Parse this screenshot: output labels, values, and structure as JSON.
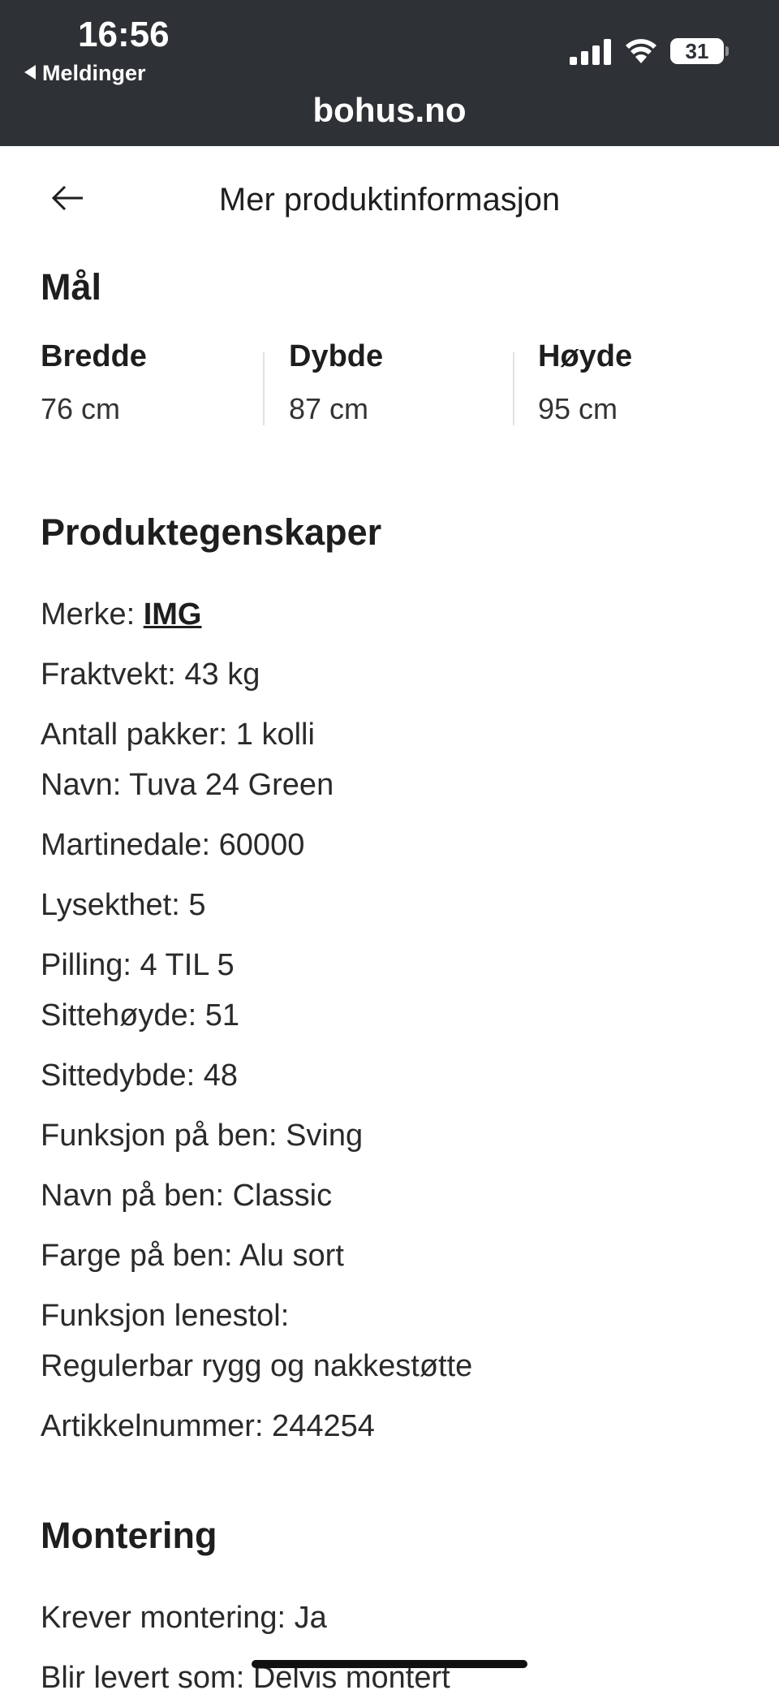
{
  "status_bar": {
    "time": "16:56",
    "back_app_label": "Meldinger",
    "battery_level": "31",
    "domain": "bohus.no"
  },
  "header": {
    "title": "Mer produktinformasjon"
  },
  "dimensions": {
    "section_title": "Mål",
    "items": [
      {
        "label": "Bredde",
        "value": "76 cm"
      },
      {
        "label": "Dybde",
        "value": "87 cm"
      },
      {
        "label": "Høyde",
        "value": "95 cm"
      }
    ]
  },
  "properties": {
    "section_title": "Produktegenskaper",
    "brand_label": "Merke: ",
    "brand_link": "IMG",
    "items": [
      "Fraktvekt: 43 kg",
      "Antall pakker: 1 kolli",
      "Navn: Tuva 24 Green",
      "Martinedale: 60000",
      "Lysekthet: 5",
      "Pilling: 4 TIL 5",
      "Sittehøyde: 51",
      "Sittedybde: 48",
      "Funksjon på ben: Sving",
      "Navn på ben: Classic",
      "Farge på ben: Alu sort",
      "Funksjon lenestol:",
      "Regulerbar rygg og nakkestøtte",
      "Artikkelnummer: 244254"
    ]
  },
  "assembly": {
    "section_title": "Montering",
    "items": [
      "Krever montering: Ja",
      "Blir levert som: Delvis montert"
    ]
  },
  "colors": {
    "status_bar_bg": "#2e3135",
    "text": "#1e1e1e",
    "divider": "#e2e2e2"
  }
}
